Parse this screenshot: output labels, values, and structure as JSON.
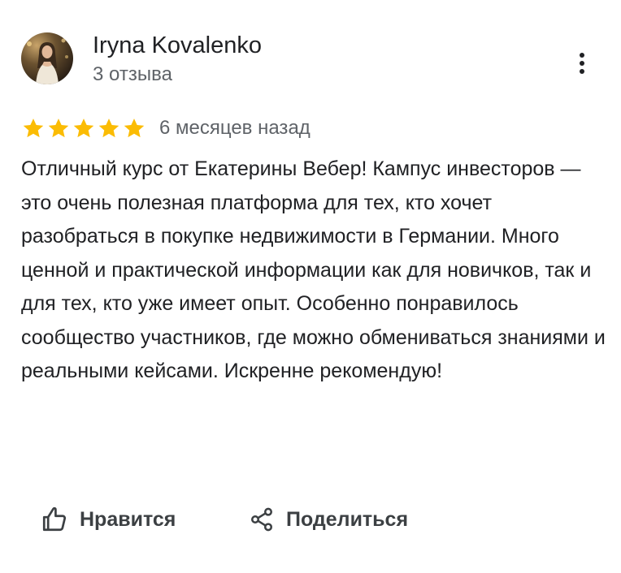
{
  "review": {
    "author_name": "Iryna Kovalenko",
    "review_count": "3 отзыва",
    "rating": 5,
    "rating_max": 5,
    "date": "6 месяцев назад",
    "text": "Отличный курс от Екатерины Вебер! Кампус инвесторов — это очень полезная платформа для тех, кто хочет разобраться в покупке недвижимости в Германии. Много ценной и практической информации как для новичков, так и для тех, кто уже имеет опыт. Особенно понравилось сообщество участников, где можно обмениваться знаниями и реальными кейсами. Искренне рекомендую!"
  },
  "actions": {
    "like_label": "Нравится",
    "share_label": "Поделиться"
  },
  "icons": {
    "more": "more-vert-icon",
    "like": "thumb-up-icon",
    "share": "share-icon",
    "star": "star-icon"
  },
  "colors": {
    "star": "#fbbc04",
    "text": "#202124",
    "secondary_text": "#5f6368",
    "action_text": "#3c4043"
  }
}
